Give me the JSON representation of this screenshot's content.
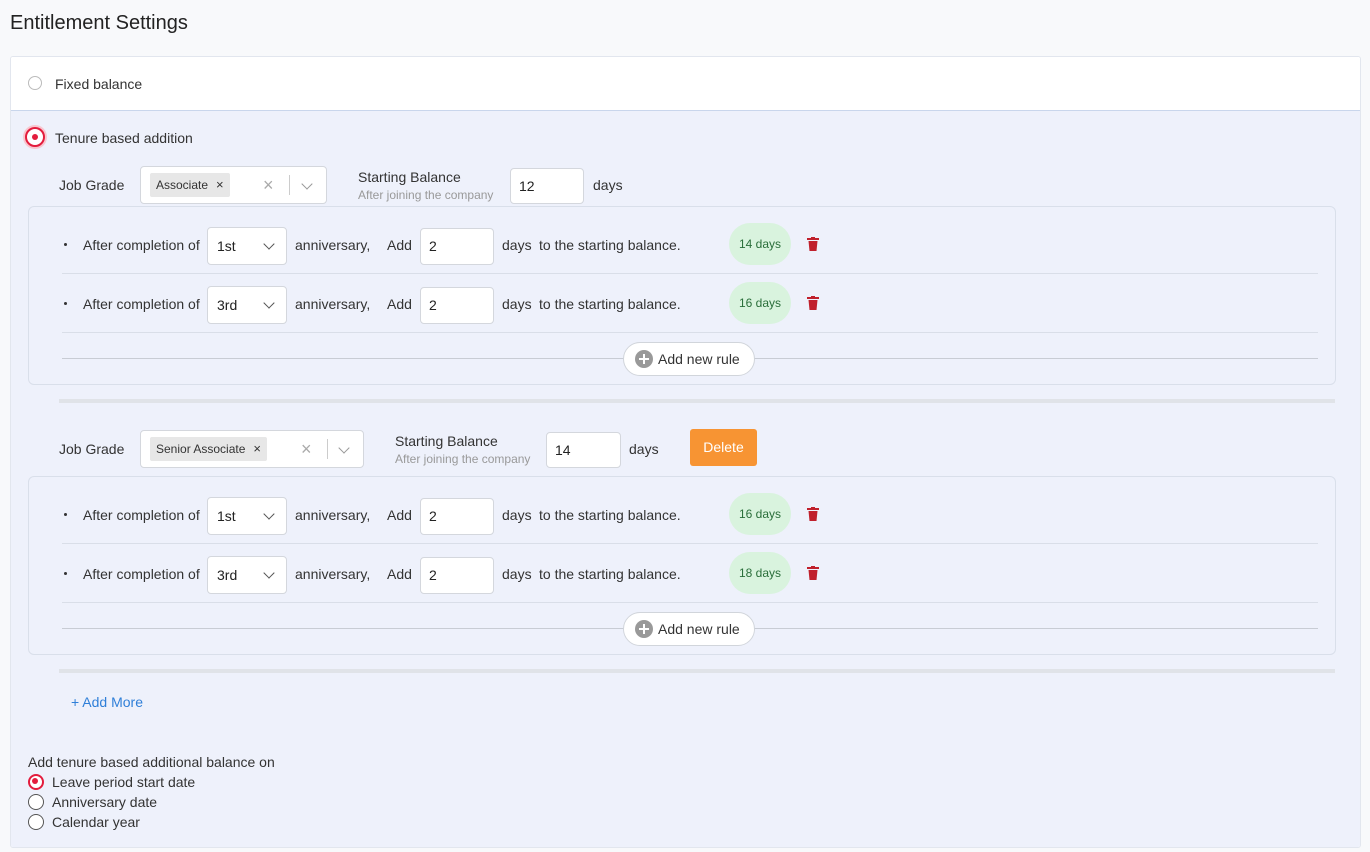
{
  "page": {
    "title": "Entitlement Settings"
  },
  "options": {
    "fixed": "Fixed balance",
    "tenure": "Tenure based addition"
  },
  "labels": {
    "job_grade": "Job Grade",
    "starting_balance": "Starting Balance",
    "after_joining": "After joining the company",
    "days": "days",
    "after_completion": "After completion of",
    "anniversary": "anniversary,",
    "add": "Add",
    "to_starting": "to the starting balance.",
    "add_new_rule": "Add new rule",
    "delete": "Delete",
    "add_more": "+ Add More"
  },
  "groups": [
    {
      "job_grade": "Associate",
      "starting_balance": "12",
      "rules": [
        {
          "anniversary": "1st",
          "add": "2",
          "total": "14 days"
        },
        {
          "anniversary": "3rd",
          "add": "2",
          "total": "16 days"
        }
      ]
    },
    {
      "job_grade": "Senior Associate",
      "starting_balance": "14",
      "rules": [
        {
          "anniversary": "1st",
          "add": "2",
          "total": "16 days"
        },
        {
          "anniversary": "3rd",
          "add": "2",
          "total": "18 days"
        }
      ]
    }
  ],
  "add_on": {
    "title": "Add tenure based additional balance on",
    "options": [
      "Leave period start date",
      "Anniversary date",
      "Calendar year"
    ],
    "selected": "Leave period start date"
  },
  "colors": {
    "accent": "#e31c3d",
    "delete": "#f79433",
    "link": "#2f7fd8",
    "badge": "#d9f3de"
  }
}
